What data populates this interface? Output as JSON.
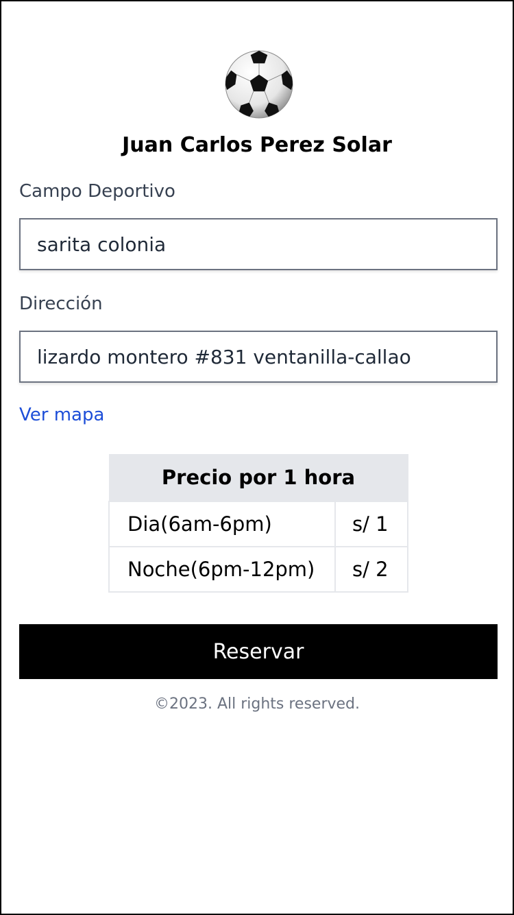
{
  "owner": {
    "name": "Juan Carlos Perez Solar"
  },
  "logo": {
    "icon": "soccer-ball-icon"
  },
  "form": {
    "campo_label": "Campo Deportivo",
    "campo_value": "sarita colonia",
    "direccion_label": "Dirección",
    "direccion_value": "lizardo montero #831 ventanilla-callao"
  },
  "map_link": "Ver mapa",
  "price_table": {
    "header": "Precio por 1 hora",
    "rows": [
      {
        "period": "Dia(6am-6pm)",
        "price": "s/ 1"
      },
      {
        "period": "Noche(6pm-12pm)",
        "price": "s/ 2"
      }
    ]
  },
  "reserve_button": "Reservar",
  "footer": "©2023. All rights reserved.",
  "colors": {
    "link": "#1d4ed8",
    "button_bg": "#000000",
    "table_header_bg": "#e5e7eb"
  }
}
